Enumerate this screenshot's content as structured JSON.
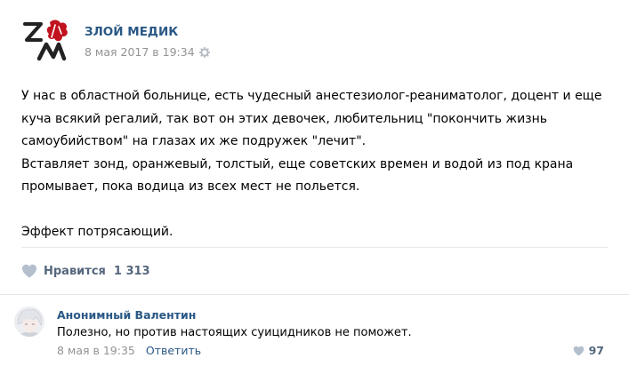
{
  "post": {
    "author": "ЗЛОЙ МЕДИК",
    "date": "8 мая 2017 в 19:34",
    "paragraphs": [
      "У нас в областной больнице, есть чудесный анестезиолог-реаниматолог, доцент и еще куча всякий регалий, так вот он этих девочек, любительниц \"покончить жизнь самоубийством\" на глазах их же подружек \"лечит\".",
      "Вставляет зонд, оранжевый, толстый, еще советских времен и водой из под крана промывает, пока водица из всех мест не польется.",
      "",
      "Эффект потрясающий."
    ]
  },
  "likes": {
    "label": "Нравится",
    "count": "1 313"
  },
  "comment": {
    "author": "Анонимный Валентин",
    "text": "Полезно, но против настоящих суицидников не поможет.",
    "date": "8 мая в 19:35",
    "reply_label": "Ответить",
    "likes": "97"
  },
  "colors": {
    "link": "#2a5885",
    "meta": "#939393",
    "logo_red": "#c0121f",
    "heart": "#b4bfcd"
  }
}
